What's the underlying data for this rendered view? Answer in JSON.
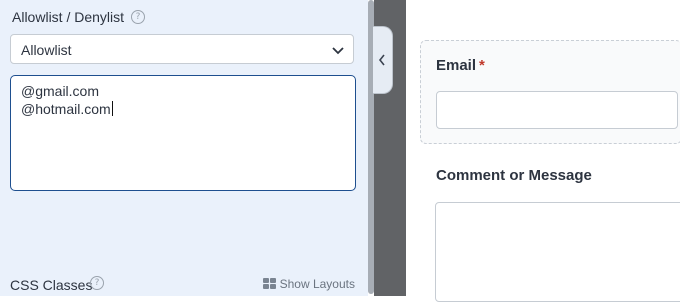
{
  "sidebar": {
    "allowlist_label": "Allowlist / Denylist",
    "mode_select": {
      "selected": "Allowlist"
    },
    "list_entries": [
      "@gmail.com",
      "@hotmail.com"
    ],
    "css_classes_label": "CSS Classes",
    "show_layouts_label": "Show Layouts"
  },
  "preview": {
    "email_label": "Email",
    "email_required_marker": "*",
    "comment_label": "Comment or Message"
  },
  "icons": {
    "help": "help-icon",
    "dropdown": "chevron-down-icon",
    "collapse": "chevron-left-icon",
    "layouts": "grid-icon"
  },
  "colors": {
    "panel_bg": "#eaf1fb",
    "focus_border": "#1e4f8f",
    "required": "#c0392b",
    "gutter": "#616366"
  }
}
